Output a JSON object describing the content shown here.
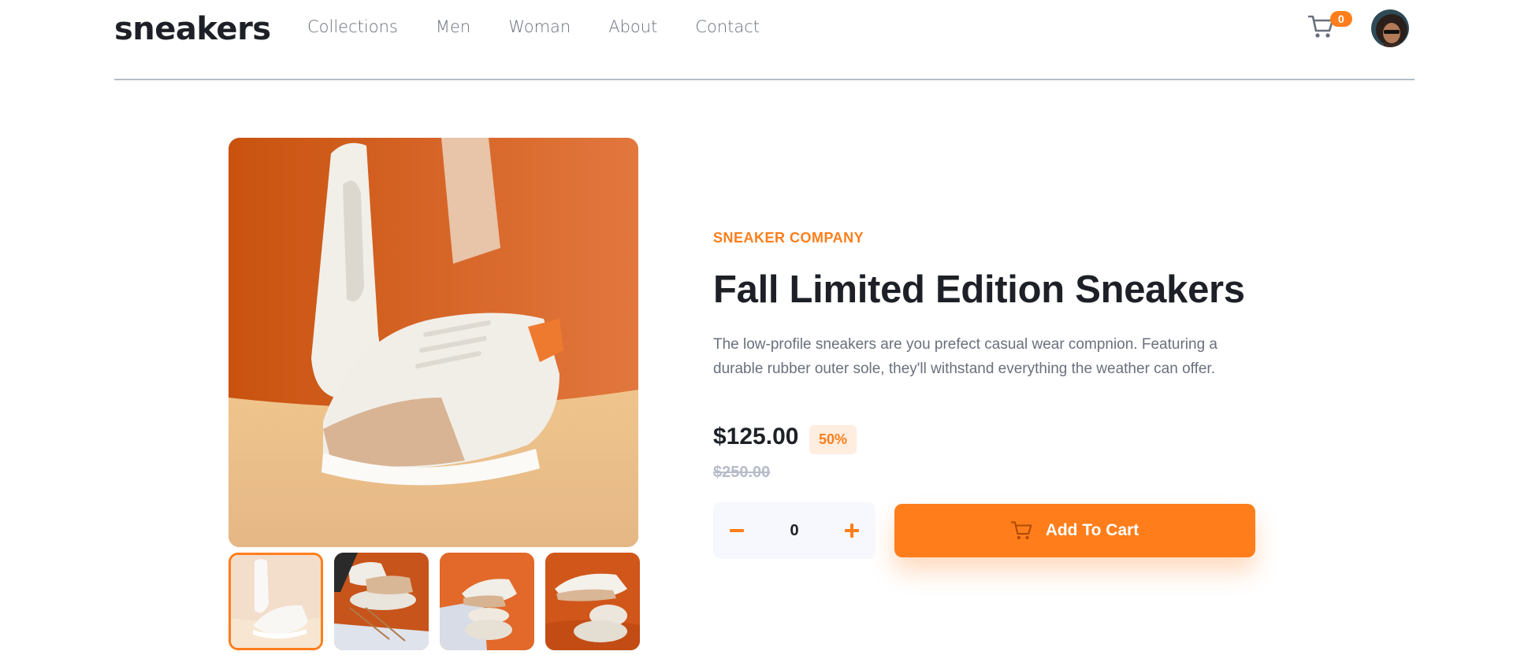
{
  "header": {
    "logo": "sneakers",
    "nav": [
      "Collections",
      "Men",
      "Woman",
      "About",
      "Contact"
    ],
    "cart_count": "0",
    "cart_icon": "cart-icon",
    "avatar": "user-avatar"
  },
  "gallery": {
    "main_image": "white sneaker on orange background",
    "thumbnails": [
      "white sneaker thumbnail",
      "sneakers stacked on stones",
      "sneaker on stones orange backdrop",
      "sneaker on pebble orange backdrop"
    ],
    "active_thumbnail": 1
  },
  "product": {
    "company": "SNEAKER COMPANY",
    "title": "Fall Limited Edition Sneakers",
    "description": "The low-profile sneakers are you prefect casual wear compnion. Featuring a durable rubber outer sole, they'll withstand everything the weather can offer.",
    "price": "$125.00",
    "discount": "50%",
    "original_price": "$250.00",
    "quantity": "0",
    "add_to_cart_label": "Add To Cart"
  },
  "colors": {
    "accent": "#ff7e1b",
    "accent_pale": "#ffede0",
    "text_dark": "#1d2026",
    "text_grey": "#69707d",
    "stepper_bg": "#f7f8fd"
  }
}
